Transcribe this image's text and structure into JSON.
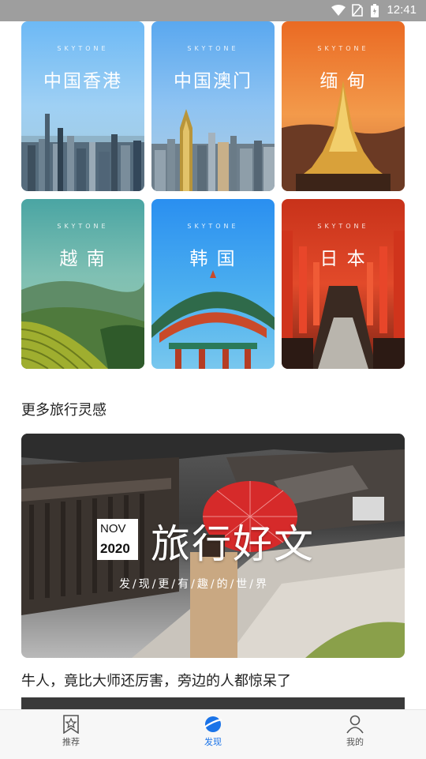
{
  "status_bar": {
    "time": "12:41"
  },
  "destinations": [
    {
      "brand": "SKYTONE",
      "name": "中国香港"
    },
    {
      "brand": "SKYTONE",
      "name": "中国澳门"
    },
    {
      "brand": "SKYTONE",
      "name": "缅 甸"
    },
    {
      "brand": "SKYTONE",
      "name": "越 南"
    },
    {
      "brand": "SKYTONE",
      "name": "韩 国"
    },
    {
      "brand": "SKYTONE",
      "name": "日 本"
    }
  ],
  "section": {
    "title": "更多旅行灵感"
  },
  "banner": {
    "month": "NOV",
    "year": "2020",
    "title": "旅行好文",
    "subtitle": "发/现/更/有/趣/的/世/界"
  },
  "article": {
    "title": "牛人，竟比大师还厉害，旁边的人都惊呆了"
  },
  "tabs": [
    {
      "label": "推荐",
      "icon": "star-bookmark-icon"
    },
    {
      "label": "发现",
      "icon": "planet-icon"
    },
    {
      "label": "我的",
      "icon": "person-icon"
    }
  ],
  "colors": {
    "accent": "#1a73e8",
    "status_bar": "#9e9e9e"
  }
}
